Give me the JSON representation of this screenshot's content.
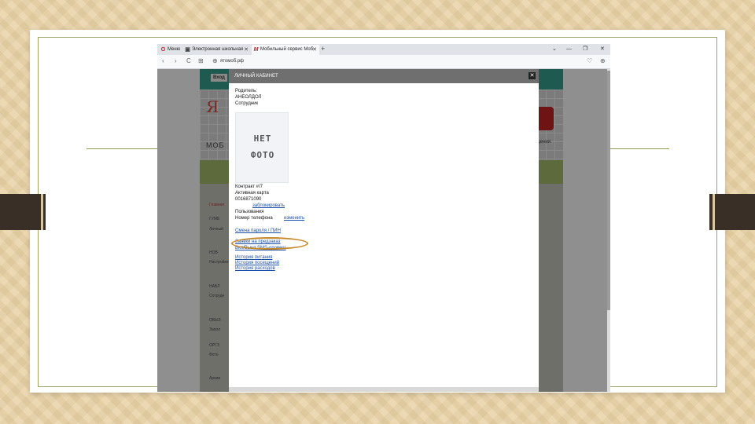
{
  "browser": {
    "tabs": [
      {
        "icon": "O",
        "title": "Меню",
        "active": false
      },
      {
        "icon": "▣",
        "title": "Электронная школьная",
        "active": false
      },
      {
        "icon": "M",
        "title": "Мобильный сервис Моб",
        "active": true
      }
    ],
    "tab_close": "✕",
    "new_tab": "+",
    "window_controls": {
      "collapse": "⌄",
      "minimize": "—",
      "restore": "❐",
      "close": "✕"
    },
    "nav": {
      "back": "‹",
      "forward": "›",
      "reload": "C",
      "grid": "⊞",
      "globe": "⊕",
      "url": "ятомоб.рф",
      "heart": "♡",
      "download": "⊕"
    }
  },
  "site": {
    "top_button": "Вход",
    "logo_letters": "Я",
    "logo_sub": "МОБ",
    "logo_right": "щения",
    "sidebar_items": [
      "Главная",
      "ГУМБ",
      "Личный",
      "НОВ",
      "Настройки",
      "НАБЛ",
      "Сотрудн",
      "ОБЫЗ",
      "Запол",
      "ОРГЗ",
      "Фото",
      "Архив"
    ]
  },
  "modal": {
    "title": "ЛИЧНЫЙ КАБИНЕТ",
    "close": "✕",
    "lines": [
      "Родитель:",
      "АНЕОЛДОЛ",
      "Сотрудник"
    ],
    "photo_text": [
      "НЕТ",
      "ФОТО"
    ],
    "contract": "Контракт #/7",
    "active_card": "Активная карта",
    "card_number": "0016871090",
    "block_link": "заблокировать",
    "dependants": "Пользования",
    "number_label": "Номер телефона",
    "change_link": "изменить",
    "links": [
      "Смена пароля / ПИН",
      "Заявки на предзаказ",
      "Вкл/Выкл SMS-оповещ"
    ],
    "links2": [
      "История питания",
      "История посещений",
      "История расходов"
    ]
  }
}
